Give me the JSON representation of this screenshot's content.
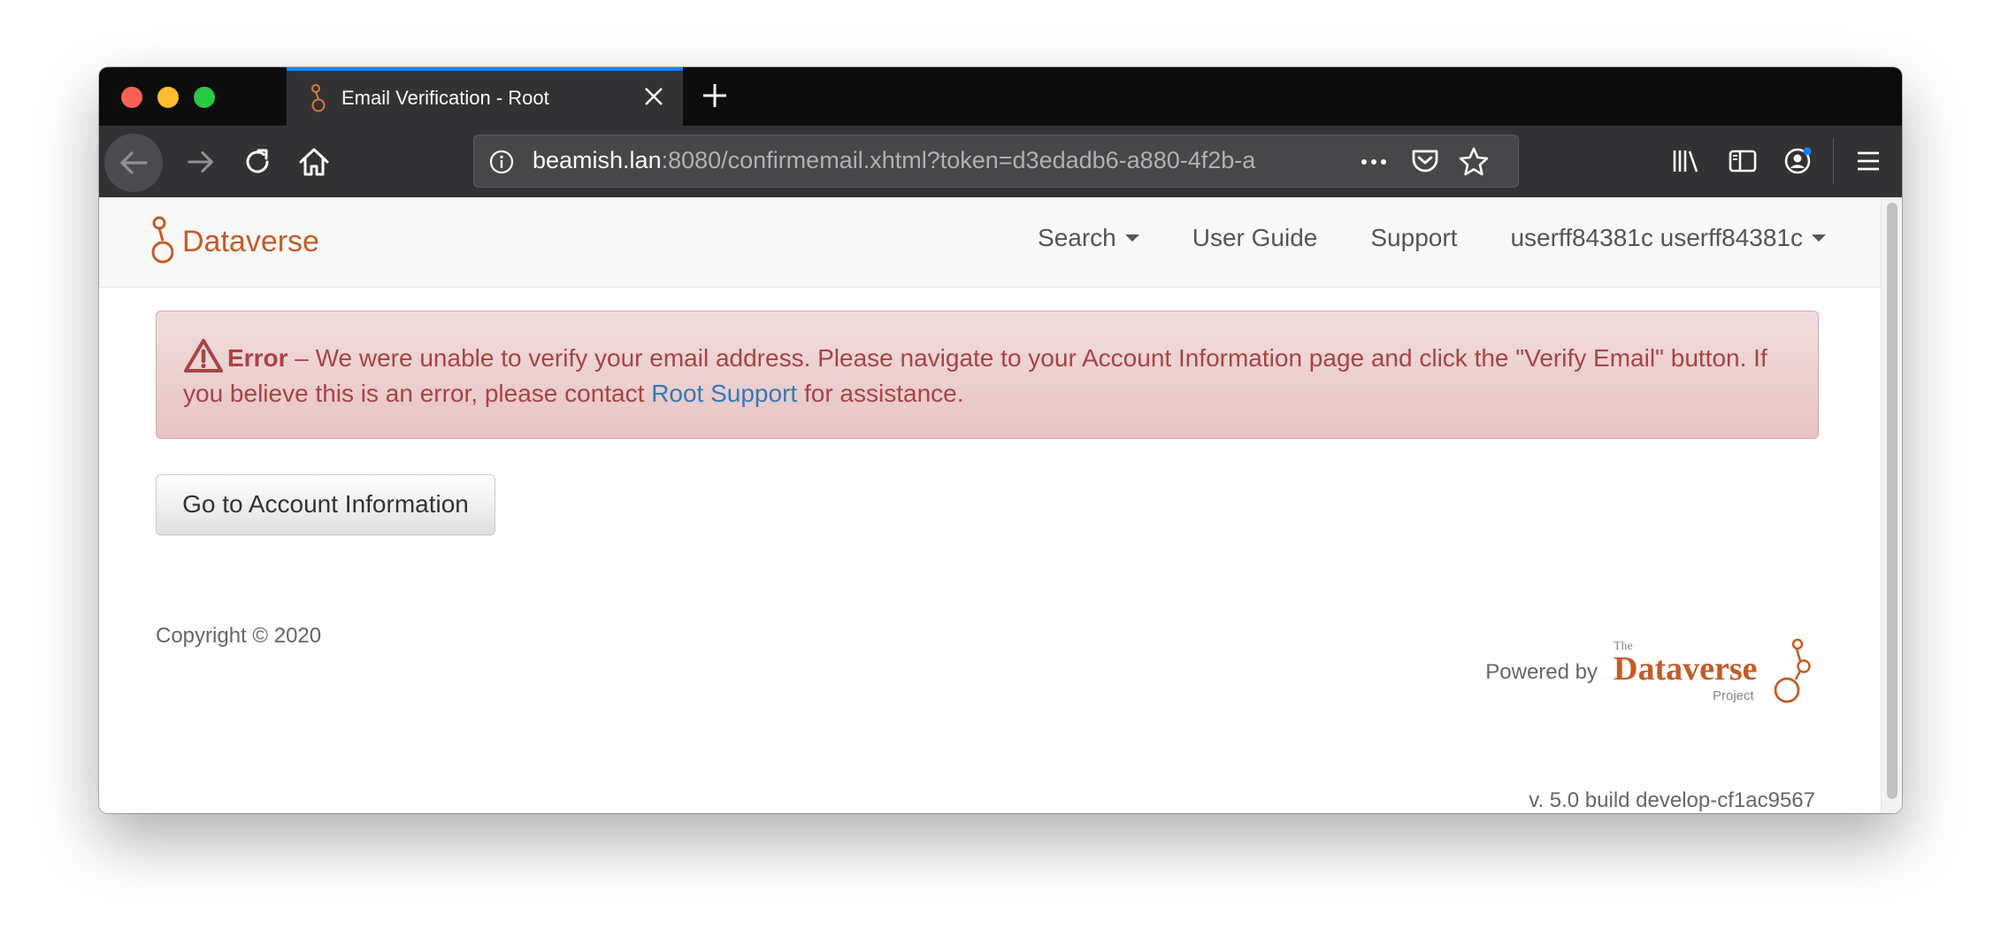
{
  "browser": {
    "tab_title": "Email Verification - Root",
    "url_host": "beamish.lan",
    "url_path": ":8080/confirmemail.xhtml?token=d3edadb6-a880-4f2b-a"
  },
  "navbar": {
    "brand": "Dataverse",
    "search_label": "Search",
    "user_guide_label": "User Guide",
    "support_label": "Support",
    "user_label": "userff84381c userff84381c"
  },
  "alert": {
    "title": "Error",
    "dash": " – ",
    "message": "We were unable to verify your email address. Please navigate to your Account Information page and click the \"Verify Email\" button. If you believe this is an error, please contact ",
    "link_text": "Root Support",
    "message_end": " for assistance."
  },
  "actions": {
    "account_button": "Go to Account Information"
  },
  "footer": {
    "copyright": "Copyright © 2020",
    "powered_by": "Powered by",
    "logo_the": "The",
    "logo_name": "Dataverse",
    "logo_project": "Project",
    "version": "v. 5.0 build develop-cf1ac9567"
  },
  "colors": {
    "brand": "#c55b28",
    "alert_text": "#a94442",
    "alert_bg": "#f2dede",
    "link": "#337ab7",
    "tab_accent": "#0a84ff"
  },
  "icons": [
    "close-icon",
    "plus-icon",
    "back-arrow-icon",
    "forward-arrow-icon",
    "reload-icon",
    "home-icon",
    "info-icon",
    "more-dots-icon",
    "pocket-icon",
    "star-icon",
    "library-icon",
    "sidebar-icon",
    "account-icon",
    "hamburger-icon",
    "warning-icon",
    "dataverse-logo-icon"
  ]
}
